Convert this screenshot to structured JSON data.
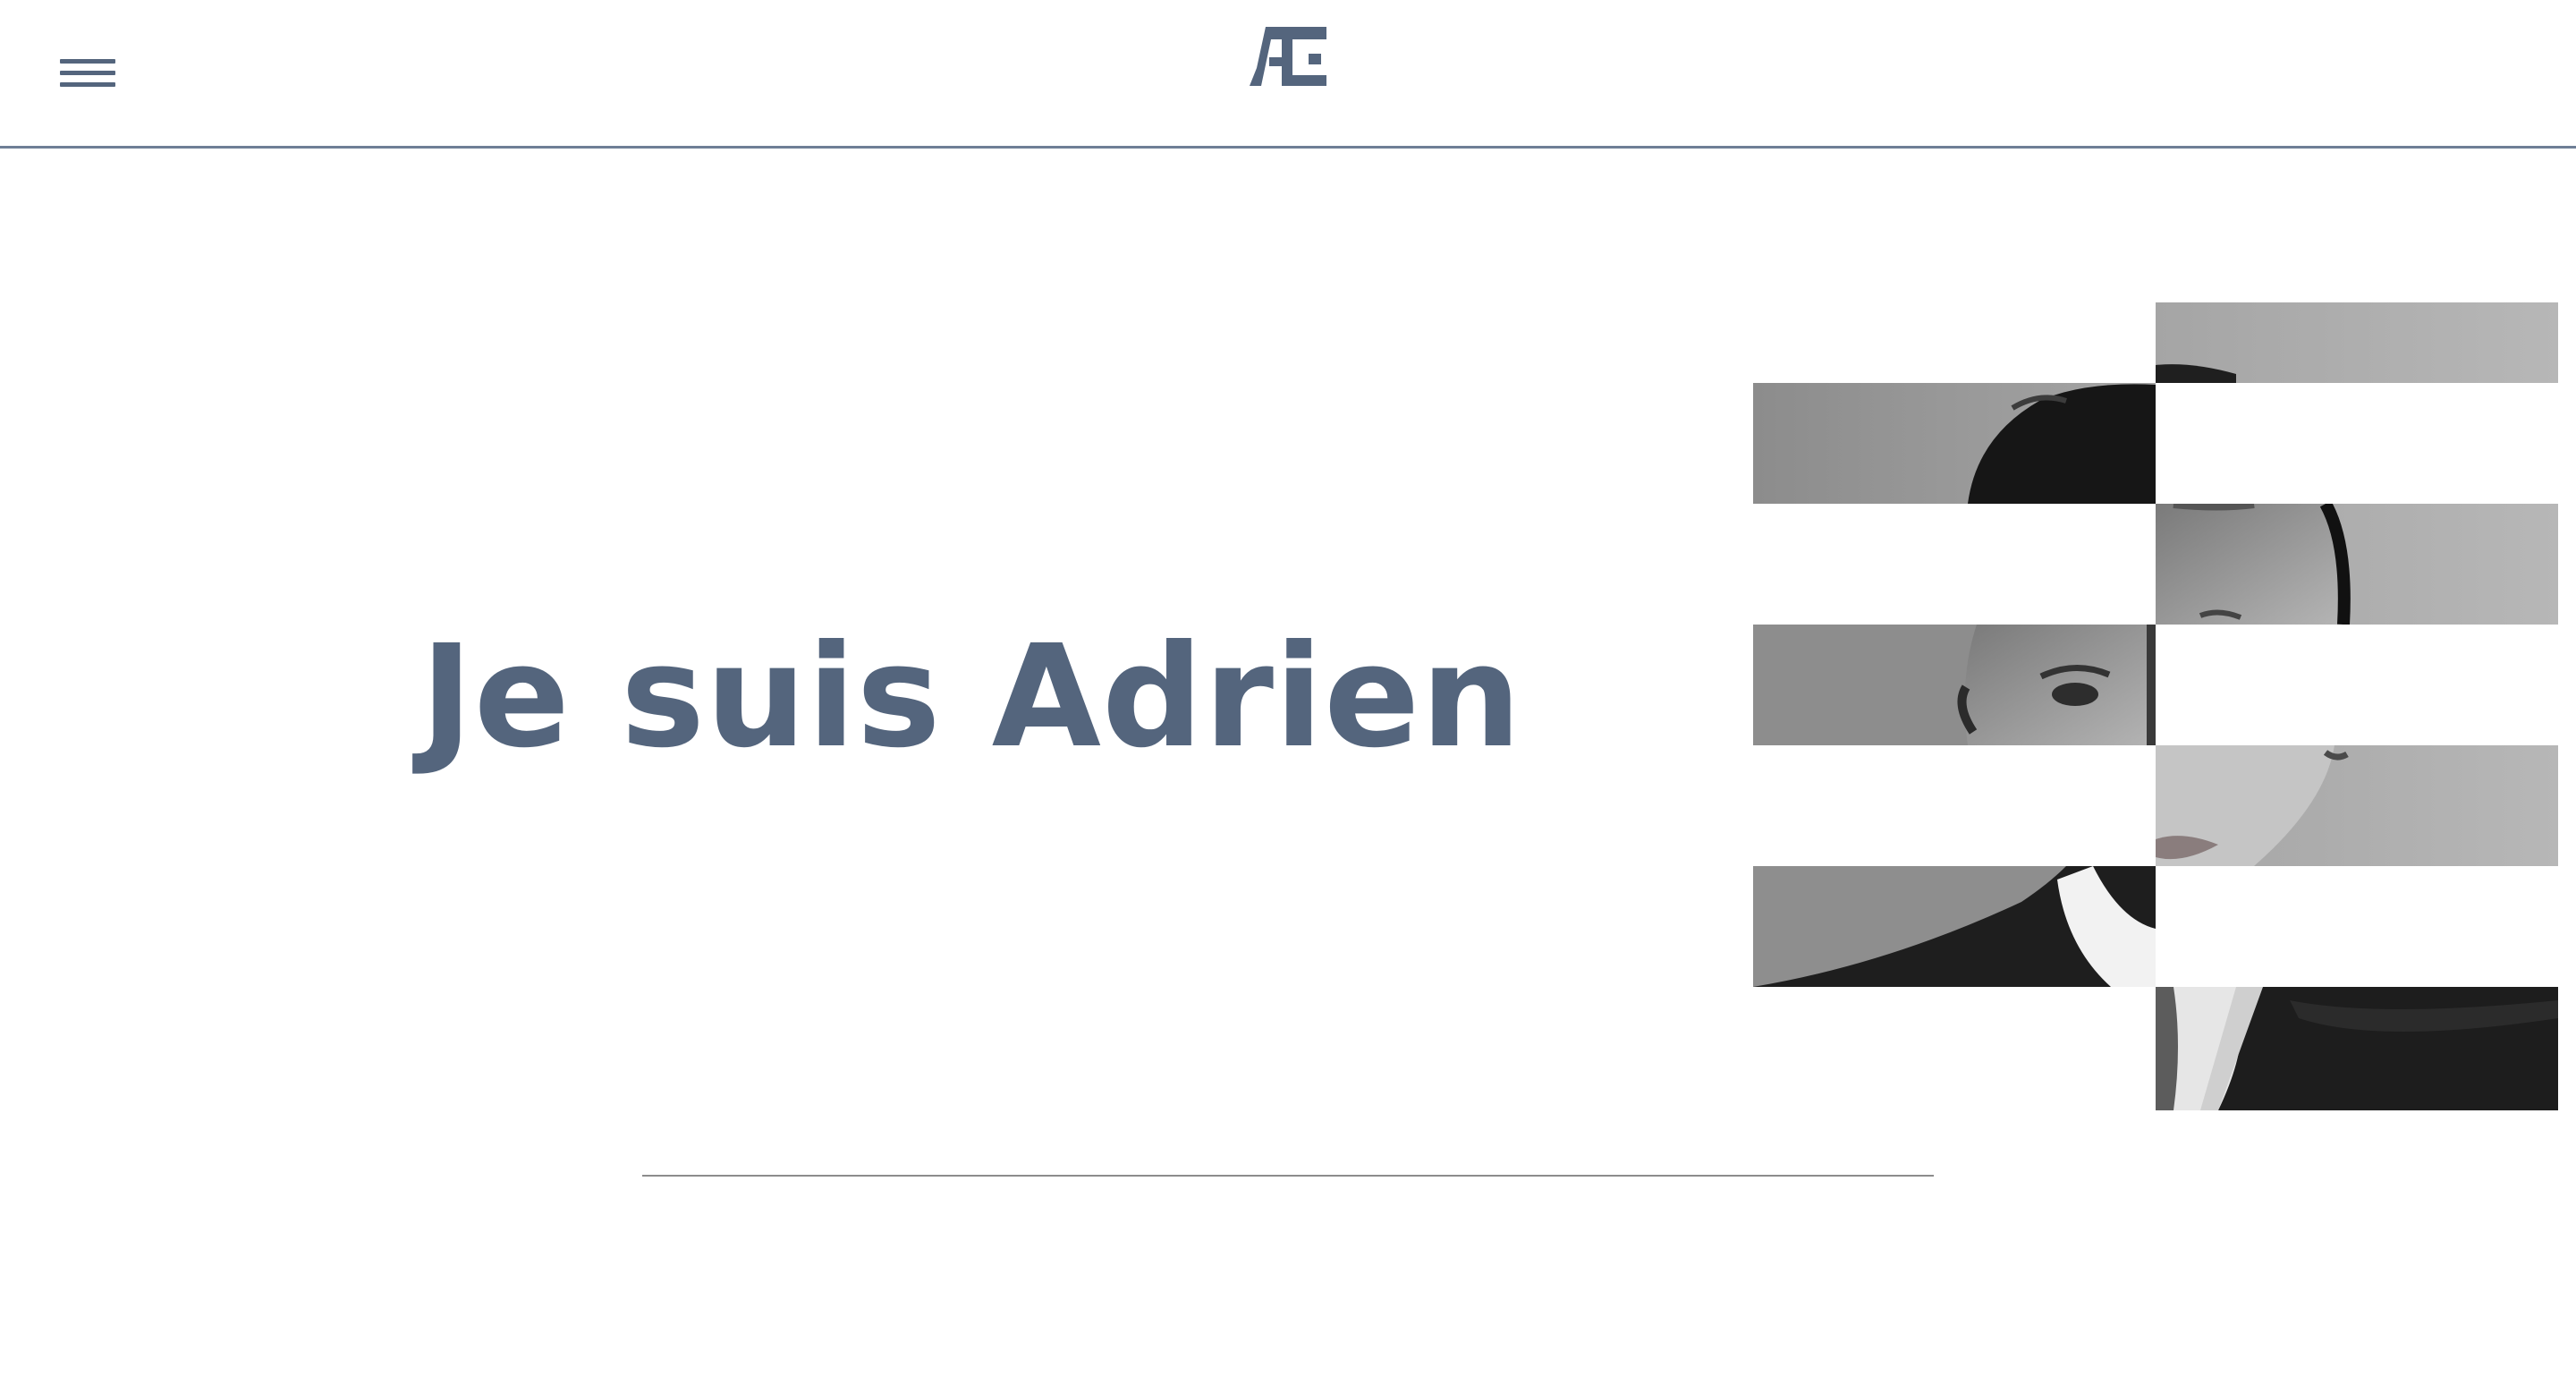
{
  "header": {
    "menu_icon": "hamburger-menu-icon",
    "logo_icon": "ae-monogram-logo",
    "border_color": "#6e7f96"
  },
  "hero": {
    "title": "Je suis Adrien",
    "title_color": "#54657d"
  },
  "portrait": {
    "description_icon": "striped-grayscale-portrait"
  },
  "colors": {
    "accent": "#54657d",
    "background": "#ffffff",
    "divider": "#8c8c8c"
  }
}
